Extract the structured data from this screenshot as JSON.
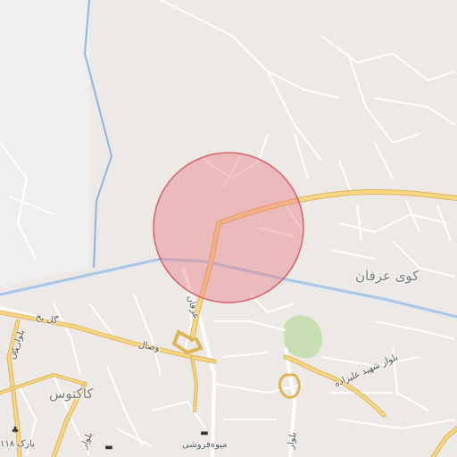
{
  "map": {
    "area_labels": {
      "kuy_erfan": "کوی عرفان",
      "kaktus": "کاکتوس"
    },
    "road_labels": {
      "erfan": "عرفان",
      "vesal": "وصال",
      "gol_yakh": "گل یخ",
      "blvd_ali_zadeh": "بلوار شهید علیزاده",
      "blvd_s": "بلوار س",
      "blvd_left": "بلوار",
      "blvd_bottom": "بلوار",
      "num_12": "۱۲"
    },
    "poi_labels": {
      "park_118": "پارک ۱۱۸",
      "fruit_shop": "میوه‌فروشی"
    },
    "search_circle": {
      "fill": "#e8808a",
      "stroke": "#d9606c"
    },
    "colors": {
      "land": "#ece9e6",
      "highway": "#f3c96e",
      "road": "#ffffff",
      "water": "#8fb6e0",
      "park": "#c8dfb4"
    },
    "icons": [
      "tree-icon",
      "shop-icon",
      "shop-icon"
    ]
  }
}
